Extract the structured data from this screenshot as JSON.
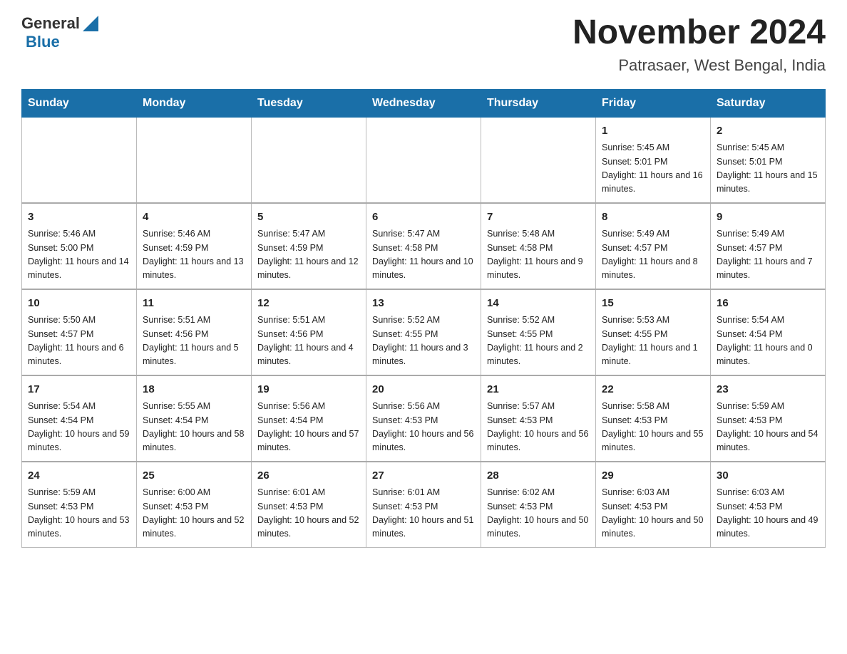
{
  "header": {
    "logo": {
      "text_general": "General",
      "text_blue": "Blue"
    },
    "title": "November 2024",
    "subtitle": "Patrasaer, West Bengal, India"
  },
  "days_of_week": [
    "Sunday",
    "Monday",
    "Tuesday",
    "Wednesday",
    "Thursday",
    "Friday",
    "Saturday"
  ],
  "weeks": [
    {
      "days": [
        {
          "number": "",
          "info": ""
        },
        {
          "number": "",
          "info": ""
        },
        {
          "number": "",
          "info": ""
        },
        {
          "number": "",
          "info": ""
        },
        {
          "number": "",
          "info": ""
        },
        {
          "number": "1",
          "info": "Sunrise: 5:45 AM\nSunset: 5:01 PM\nDaylight: 11 hours and 16 minutes."
        },
        {
          "number": "2",
          "info": "Sunrise: 5:45 AM\nSunset: 5:01 PM\nDaylight: 11 hours and 15 minutes."
        }
      ]
    },
    {
      "days": [
        {
          "number": "3",
          "info": "Sunrise: 5:46 AM\nSunset: 5:00 PM\nDaylight: 11 hours and 14 minutes."
        },
        {
          "number": "4",
          "info": "Sunrise: 5:46 AM\nSunset: 4:59 PM\nDaylight: 11 hours and 13 minutes."
        },
        {
          "number": "5",
          "info": "Sunrise: 5:47 AM\nSunset: 4:59 PM\nDaylight: 11 hours and 12 minutes."
        },
        {
          "number": "6",
          "info": "Sunrise: 5:47 AM\nSunset: 4:58 PM\nDaylight: 11 hours and 10 minutes."
        },
        {
          "number": "7",
          "info": "Sunrise: 5:48 AM\nSunset: 4:58 PM\nDaylight: 11 hours and 9 minutes."
        },
        {
          "number": "8",
          "info": "Sunrise: 5:49 AM\nSunset: 4:57 PM\nDaylight: 11 hours and 8 minutes."
        },
        {
          "number": "9",
          "info": "Sunrise: 5:49 AM\nSunset: 4:57 PM\nDaylight: 11 hours and 7 minutes."
        }
      ]
    },
    {
      "days": [
        {
          "number": "10",
          "info": "Sunrise: 5:50 AM\nSunset: 4:57 PM\nDaylight: 11 hours and 6 minutes."
        },
        {
          "number": "11",
          "info": "Sunrise: 5:51 AM\nSunset: 4:56 PM\nDaylight: 11 hours and 5 minutes."
        },
        {
          "number": "12",
          "info": "Sunrise: 5:51 AM\nSunset: 4:56 PM\nDaylight: 11 hours and 4 minutes."
        },
        {
          "number": "13",
          "info": "Sunrise: 5:52 AM\nSunset: 4:55 PM\nDaylight: 11 hours and 3 minutes."
        },
        {
          "number": "14",
          "info": "Sunrise: 5:52 AM\nSunset: 4:55 PM\nDaylight: 11 hours and 2 minutes."
        },
        {
          "number": "15",
          "info": "Sunrise: 5:53 AM\nSunset: 4:55 PM\nDaylight: 11 hours and 1 minute."
        },
        {
          "number": "16",
          "info": "Sunrise: 5:54 AM\nSunset: 4:54 PM\nDaylight: 11 hours and 0 minutes."
        }
      ]
    },
    {
      "days": [
        {
          "number": "17",
          "info": "Sunrise: 5:54 AM\nSunset: 4:54 PM\nDaylight: 10 hours and 59 minutes."
        },
        {
          "number": "18",
          "info": "Sunrise: 5:55 AM\nSunset: 4:54 PM\nDaylight: 10 hours and 58 minutes."
        },
        {
          "number": "19",
          "info": "Sunrise: 5:56 AM\nSunset: 4:54 PM\nDaylight: 10 hours and 57 minutes."
        },
        {
          "number": "20",
          "info": "Sunrise: 5:56 AM\nSunset: 4:53 PM\nDaylight: 10 hours and 56 minutes."
        },
        {
          "number": "21",
          "info": "Sunrise: 5:57 AM\nSunset: 4:53 PM\nDaylight: 10 hours and 56 minutes."
        },
        {
          "number": "22",
          "info": "Sunrise: 5:58 AM\nSunset: 4:53 PM\nDaylight: 10 hours and 55 minutes."
        },
        {
          "number": "23",
          "info": "Sunrise: 5:59 AM\nSunset: 4:53 PM\nDaylight: 10 hours and 54 minutes."
        }
      ]
    },
    {
      "days": [
        {
          "number": "24",
          "info": "Sunrise: 5:59 AM\nSunset: 4:53 PM\nDaylight: 10 hours and 53 minutes."
        },
        {
          "number": "25",
          "info": "Sunrise: 6:00 AM\nSunset: 4:53 PM\nDaylight: 10 hours and 52 minutes."
        },
        {
          "number": "26",
          "info": "Sunrise: 6:01 AM\nSunset: 4:53 PM\nDaylight: 10 hours and 52 minutes."
        },
        {
          "number": "27",
          "info": "Sunrise: 6:01 AM\nSunset: 4:53 PM\nDaylight: 10 hours and 51 minutes."
        },
        {
          "number": "28",
          "info": "Sunrise: 6:02 AM\nSunset: 4:53 PM\nDaylight: 10 hours and 50 minutes."
        },
        {
          "number": "29",
          "info": "Sunrise: 6:03 AM\nSunset: 4:53 PM\nDaylight: 10 hours and 50 minutes."
        },
        {
          "number": "30",
          "info": "Sunrise: 6:03 AM\nSunset: 4:53 PM\nDaylight: 10 hours and 49 minutes."
        }
      ]
    }
  ]
}
